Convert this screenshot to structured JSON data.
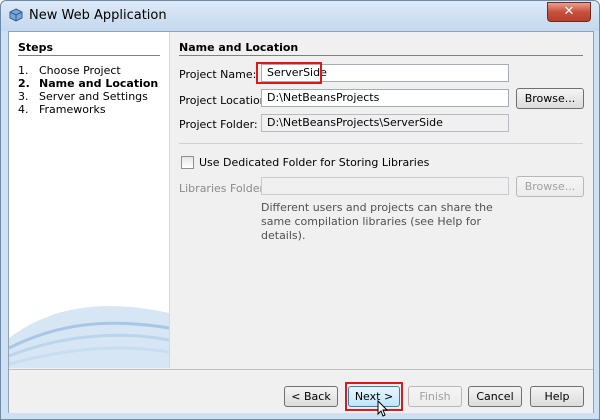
{
  "window": {
    "title": "New Web Application",
    "close_label": "✕"
  },
  "steps": {
    "title": "Steps",
    "items": [
      {
        "num": "1.",
        "label": "Choose Project"
      },
      {
        "num": "2.",
        "label": "Name and Location"
      },
      {
        "num": "3.",
        "label": "Server and Settings"
      },
      {
        "num": "4.",
        "label": "Frameworks"
      }
    ],
    "current_index": 1
  },
  "form": {
    "section_title": "Name and Location",
    "project_name_label": "Project Name:",
    "project_name_value": "ServerSide",
    "project_location_label": "Project Location:",
    "project_location_value": "D:\\NetBeansProjects",
    "browse_label": "Browse...",
    "project_folder_label": "Project Folder:",
    "project_folder_value": "D:\\NetBeansProjects\\ServerSide",
    "dedicated_folder_label": "Use Dedicated Folder for Storing Libraries",
    "dedicated_folder_checked": false,
    "libraries_folder_label": "Libraries Folder:",
    "libraries_folder_value": "",
    "libraries_browse_label": "Browse...",
    "hint_text": "Different users and projects can share the same compilation libraries (see Help for details)."
  },
  "buttons": {
    "back": "< Back",
    "next": "Next >",
    "finish": "Finish",
    "cancel": "Cancel",
    "help": "Help"
  },
  "colors": {
    "highlight": "#d81c1c",
    "title_bar": "#c4d8ee",
    "close_button": "#c8503a"
  }
}
